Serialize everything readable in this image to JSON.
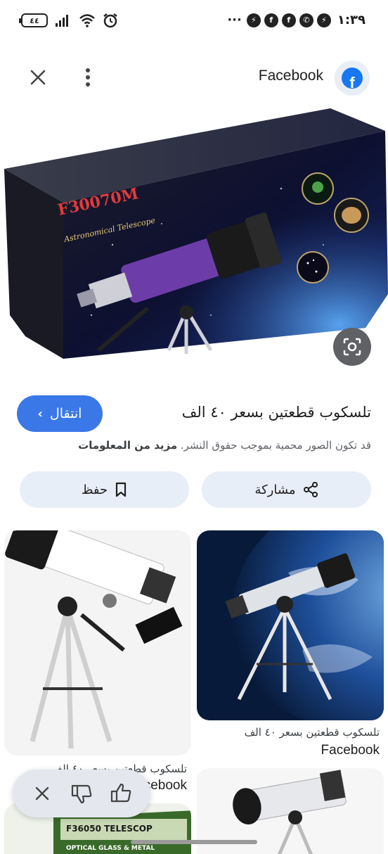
{
  "status_bar": {
    "battery": "٤٤",
    "time": "١:٣٩",
    "more": "···"
  },
  "header": {
    "source_name": "Facebook",
    "logo_letter": "f"
  },
  "main_image": {
    "box_title": "F30070M",
    "box_subtitle": "Astronomical Telescope"
  },
  "result": {
    "title": "تلسكوب قطعتين بسعر ٤٠ الف",
    "visit_label": "انتقال",
    "copyright_text": "قد تكون الصور محمية بموجب حقوق النشر.",
    "learn_more": "مزيد من المعلومات"
  },
  "actions": {
    "share_label": "مشاركة",
    "save_label": "حفظ"
  },
  "related": [
    {
      "title": "تلسكوب قطعتين بسعر ٤٠ الف",
      "source": "Facebook"
    },
    {
      "title": "تلسكوب قطعتين بسعر ٤٠ الف",
      "source": "Facebook"
    },
    {
      "title": "",
      "source": ""
    },
    {
      "title": "",
      "source": "",
      "box_text": "F36050 TELESCOP",
      "box_sub": "OPTICAL GLASS & METAL"
    }
  ],
  "colors": {
    "accent": "#3b78e7",
    "pill_bg": "#e8eef8",
    "facebook": "#1877f2"
  }
}
